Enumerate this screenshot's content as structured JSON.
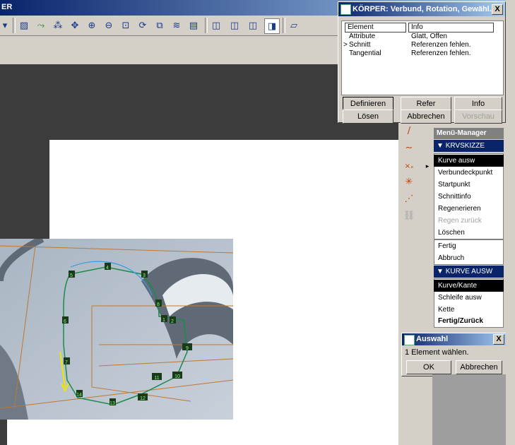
{
  "main_window": {
    "title": "ER"
  },
  "toolbar": {
    "icons": [
      "dropdown-arrow-icon",
      "sketch-icon",
      "spline-icon",
      "network-icon",
      "pan-icon",
      "zoom-in-icon",
      "zoom-out-icon",
      "zoom-fit-icon",
      "spin-icon",
      "view-orient-icon",
      "layers-icon",
      "saved-views-icon",
      "wireframe-icon",
      "hidden-line-icon",
      "no-hidden-icon",
      "shaded-icon",
      "datum-plane-icon"
    ]
  },
  "dialog": {
    "title": "KÖRPER: Verbund, Rotation, Gewähl...",
    "close": "X",
    "columns": {
      "element": "Element",
      "info": "Info"
    },
    "rows": [
      {
        "marker": "",
        "element": "Attribute",
        "info": "Glatt, Offen"
      },
      {
        "marker": ">",
        "element": "Schnitt",
        "info": "Referenzen fehlen."
      },
      {
        "marker": "",
        "element": "Tangential",
        "info": "Referenzen fehlen."
      }
    ],
    "buttons": {
      "definieren": "Definieren",
      "refer": "Refer",
      "info": "Info",
      "loesen": "Lösen",
      "abbrechen": "Abbrechen",
      "vorschau": "Vorschau"
    }
  },
  "menu_manager": {
    "title": "Menü-Manager",
    "section1": "KRVSKIZZE",
    "section1_items": [
      {
        "label": "Kurve ausw",
        "state": "selected"
      },
      {
        "label": "Verbundeckpunkt",
        "state": "normal"
      },
      {
        "label": "Startpunkt",
        "state": "normal"
      },
      {
        "label": "Schnittinfo",
        "state": "normal"
      },
      {
        "label": "Regenerieren",
        "state": "normal"
      },
      {
        "label": "Regen zurück",
        "state": "disabled"
      },
      {
        "label": "Löschen",
        "state": "normal"
      }
    ],
    "section1_actions": [
      {
        "label": "Fertig",
        "state": "normal"
      },
      {
        "label": "Abbruch",
        "state": "normal"
      }
    ],
    "section2": "KURVE AUSW",
    "section2_items": [
      {
        "label": "Kurve/Kante",
        "state": "selected"
      },
      {
        "label": "Schleife ausw",
        "state": "normal"
      },
      {
        "label": "Kette",
        "state": "normal"
      },
      {
        "label": "Fertig/Zurück",
        "state": "bold"
      }
    ]
  },
  "auswahl": {
    "title": "Auswahl",
    "close": "X",
    "message": "1 Element wählen.",
    "ok": "OK",
    "cancel": "Abbrechen"
  },
  "vertex_labels": [
    "5",
    "4",
    "3",
    "6",
    "7",
    "8",
    "1",
    "2",
    "9",
    "10",
    "11",
    "12",
    "13",
    "14",
    "15",
    "16",
    "17"
  ]
}
